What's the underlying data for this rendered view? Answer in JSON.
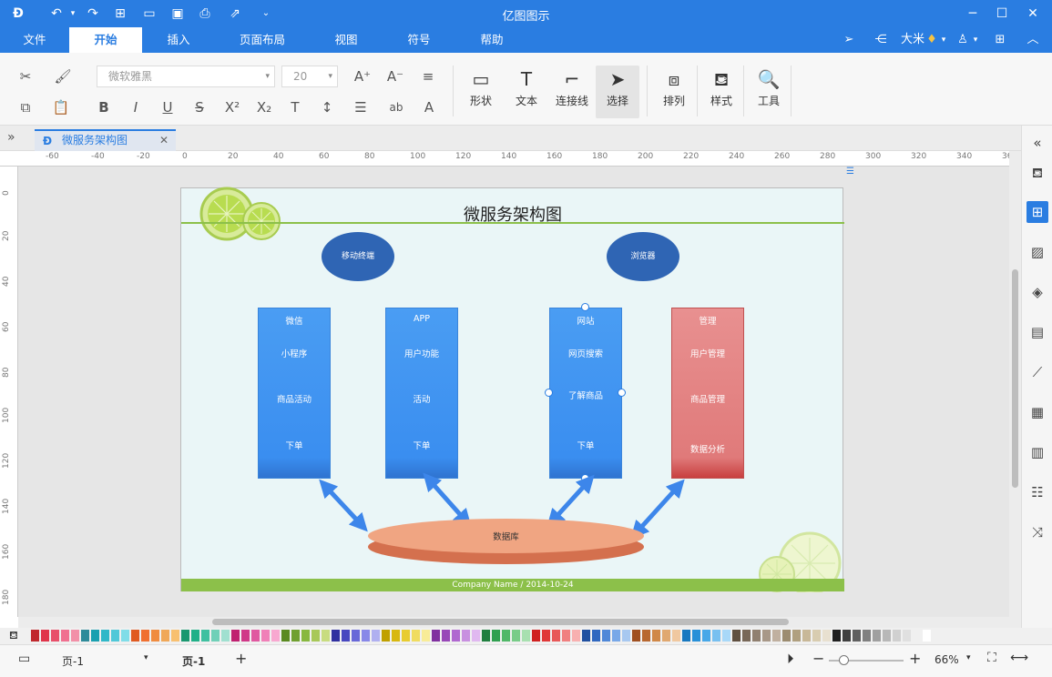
{
  "app": {
    "title": "亿图图示"
  },
  "menubar": {
    "items": [
      "文件",
      "开始",
      "插入",
      "页面布局",
      "视图",
      "符号",
      "帮助"
    ],
    "active": "开始",
    "user": "大米"
  },
  "ribbon": {
    "font_name": "微软雅黑",
    "font_size": "20",
    "buttons": {
      "shape": "形状",
      "text": "文本",
      "connector": "连接线",
      "select": "选择",
      "arrange": "排列",
      "style": "样式",
      "tools": "工具"
    }
  },
  "doc_tab": {
    "title": "微服务架构图"
  },
  "rulers": {
    "h_labels": [
      "-60",
      "-40",
      "-20",
      "0",
      "20",
      "40",
      "60",
      "80",
      "100",
      "120",
      "140",
      "160",
      "180",
      "200",
      "220",
      "240",
      "260",
      "280",
      "300",
      "320",
      "340",
      "36"
    ],
    "v_labels": [
      "0",
      "20",
      "40",
      "60",
      "80",
      "100",
      "120",
      "140",
      "160",
      "180"
    ]
  },
  "diagram": {
    "title": "微服务架构图",
    "clients": [
      "移动终端",
      "浏览器"
    ],
    "columns": [
      {
        "title": "微信",
        "items": [
          "小程序",
          "商品活动",
          "下单"
        ],
        "color": "#3a8ef0"
      },
      {
        "title": "APP",
        "items": [
          "用户功能",
          "活动",
          "下单"
        ],
        "color": "#3a8ef0"
      },
      {
        "title": "网站",
        "items": [
          "网页搜索",
          "了解商品",
          "下单"
        ],
        "color": "#3a8ef0"
      },
      {
        "title": "管理",
        "items": [
          "用户管理",
          "商品管理",
          "数据分析"
        ],
        "color": "#e07a7a"
      }
    ],
    "database": "数据库",
    "footer": "Company Name / 2014-10-24",
    "accent_green": "#8cc04a"
  },
  "palette": [
    "#c0282d",
    "#e0344a",
    "#e8506a",
    "#f07090",
    "#f290a8",
    "#2e8b9a",
    "#1aa0b0",
    "#30b8c8",
    "#50c8d8",
    "#80dde8",
    "#e05a20",
    "#f07030",
    "#f08c40",
    "#f0a858",
    "#f8c070",
    "#1a9870",
    "#20b088",
    "#40c0a0",
    "#70d0b8",
    "#a0e0d0",
    "#c02070",
    "#d03888",
    "#e058a0",
    "#f080b8",
    "#f8a8d0",
    "#5a8a20",
    "#70a030",
    "#88b840",
    "#a8c858",
    "#c8dc80",
    "#3030a0",
    "#4848c0",
    "#6868d8",
    "#8888e8",
    "#b0b0f0",
    "#c0a000",
    "#d8b810",
    "#e8cc30",
    "#f0dc60",
    "#f8ec98",
    "#8030a0",
    "#9848b8",
    "#b068d0",
    "#c890e0",
    "#e0b8f0",
    "#208040",
    "#30a050",
    "#50b868",
    "#78cc88",
    "#a8e0b0",
    "#d02020",
    "#e03838",
    "#e85858",
    "#f08080",
    "#f8b0b0",
    "#2050a0",
    "#3068c0",
    "#5088d8",
    "#78a8e8",
    "#a8c8f0",
    "#a05020",
    "#b86830",
    "#d08848",
    "#e0a870",
    "#f0c8a0",
    "#1878c0",
    "#2890d8",
    "#48a8e8",
    "#78c0f0",
    "#a8d8f8",
    "#605040",
    "#786858",
    "#908070",
    "#a89888",
    "#c0b0a0",
    "#9c8c70",
    "#b0a080",
    "#c8b898",
    "#d8ccb0",
    "#e8e0d0",
    "#202020",
    "#404040",
    "#606060",
    "#808080",
    "#a0a0a0",
    "#b8b8b8",
    "#d0d0d0",
    "#e0e0e0",
    "#f0f0f0",
    "#ffffff"
  ],
  "statusbar": {
    "page_select": "页-1",
    "page_tab": "页-1",
    "zoom": "66%"
  }
}
